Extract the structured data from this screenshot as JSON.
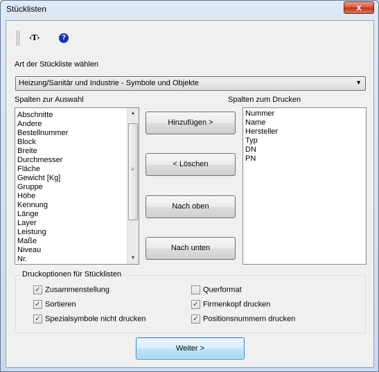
{
  "window": {
    "title": "Stücklisten",
    "close_label": "x"
  },
  "toolbar": {
    "text_icon_label": "‹T›",
    "help_icon_label": "?"
  },
  "type_label": "Art der Stückliste wählen",
  "type_select": {
    "value": "Heizung/Sanitär und Industrie - Symbole und Objekte"
  },
  "available_columns": {
    "label": "Spalten zur Auswahl",
    "items": [
      "Abschnitte",
      "Andere",
      "Bestellnummer",
      "Block",
      "Breite",
      "Durchmesser",
      "Fläche",
      "Gewicht [Kg]",
      "Gruppe",
      "Höhe",
      "Kennung",
      "Länge",
      "Layer",
      "Leistung",
      "Maße",
      "Niveau",
      "Nr."
    ]
  },
  "print_columns": {
    "label": "Spalten zum Drucken",
    "items": [
      "Nummer",
      "Name",
      "Hersteller",
      "Typ",
      "DN",
      "PN"
    ]
  },
  "buttons": {
    "add": "Hinzufügen >",
    "delete": "< Löschen",
    "up": "Nach oben",
    "down": "Nach unten",
    "next": "Weiter >"
  },
  "print_options": {
    "title": "Druckoptionen für Stücklisten",
    "options": [
      {
        "label": "Zusammenstellung",
        "checked": true
      },
      {
        "label": "Sortieren",
        "checked": true
      },
      {
        "label": "Spezialsymbole nicht drucken",
        "checked": true
      },
      {
        "label": "Querformat",
        "checked": false
      },
      {
        "label": "Firmenkopf drucken",
        "checked": true
      },
      {
        "label": "Positionsnummern drucken",
        "checked": true
      }
    ]
  }
}
